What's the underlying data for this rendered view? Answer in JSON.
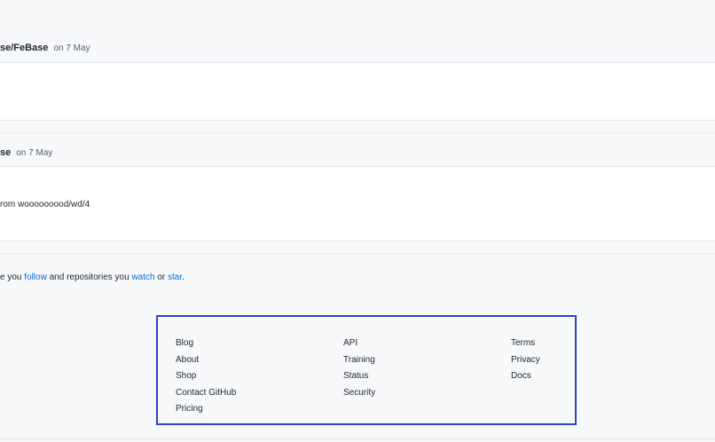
{
  "feed": {
    "event1": {
      "repo": "se/FeBase",
      "time": "on 7 May"
    },
    "event2": {
      "repo": "se",
      "time": "on 7 May",
      "body": "rom wooooooood/wd/4"
    }
  },
  "notice": {
    "prefix": "e you ",
    "follow": "follow",
    "middle": " and repositories you ",
    "watch": "watch",
    "or": " or ",
    "star": "star",
    "suffix": "."
  },
  "footer": {
    "col1": [
      "Blog",
      "About",
      "Shop",
      "Contact GitHub",
      "Pricing"
    ],
    "col2": [
      "API",
      "Training",
      "Status",
      "Security"
    ],
    "col3": [
      "Terms",
      "Privacy",
      "Docs"
    ]
  }
}
